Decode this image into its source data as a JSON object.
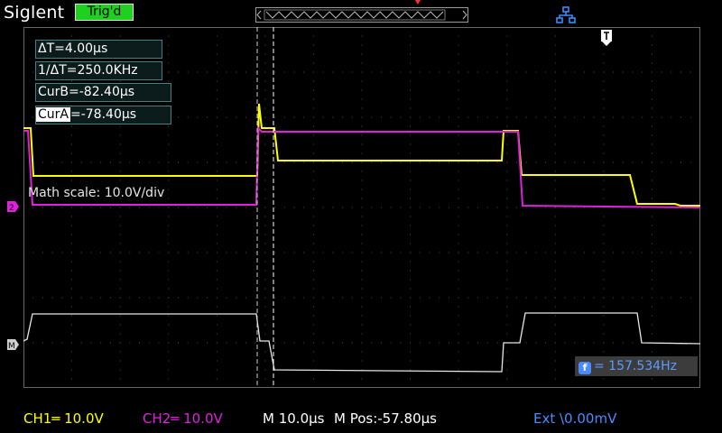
{
  "header": {
    "brand": "Siglent",
    "trigger_status": "Trig'd"
  },
  "cursors": {
    "delta_t": "ΔT=4.00μs",
    "inv_delta_t": "1/ΔT=250.0KHz",
    "cur_b": "CurB=-82.40μs",
    "cur_a_label": "CurA",
    "cur_a_value": "=-78.40μs"
  },
  "math_scale": "Math scale: 10.0V/div",
  "frequency": {
    "badge": "f",
    "value": "= 157.534Hz"
  },
  "channels": {
    "ch1": "CH1═ 10.0V",
    "ch2": "CH2═ 10.0V",
    "timebase": "M 10.0μs",
    "mpos": "M Pos:-57.80μs",
    "trigger": "Ext  \\0.00mV"
  },
  "colors": {
    "ch1": "#ffff00",
    "ch2": "#e020e0",
    "math": "#e8e8e8",
    "grid": "#555555",
    "bottom_info": "#4a8cff"
  },
  "icons": {
    "network": "network-icon",
    "trigger_marker": "trigger-position-icon",
    "ch2_marker": "ch2-ground-marker-icon",
    "math_marker": "math-ground-marker-icon"
  }
}
